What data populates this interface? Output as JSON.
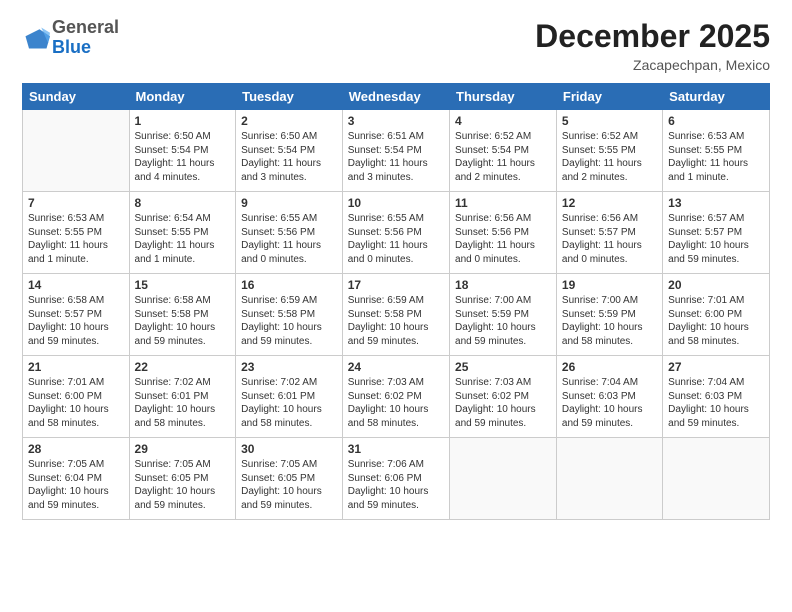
{
  "header": {
    "logo_general": "General",
    "logo_blue": "Blue",
    "month_title": "December 2025",
    "location": "Zacapechpan, Mexico"
  },
  "weekdays": [
    "Sunday",
    "Monday",
    "Tuesday",
    "Wednesday",
    "Thursday",
    "Friday",
    "Saturday"
  ],
  "weeks": [
    [
      {
        "num": "",
        "info": ""
      },
      {
        "num": "1",
        "info": "Sunrise: 6:50 AM\nSunset: 5:54 PM\nDaylight: 11 hours\nand 4 minutes."
      },
      {
        "num": "2",
        "info": "Sunrise: 6:50 AM\nSunset: 5:54 PM\nDaylight: 11 hours\nand 3 minutes."
      },
      {
        "num": "3",
        "info": "Sunrise: 6:51 AM\nSunset: 5:54 PM\nDaylight: 11 hours\nand 3 minutes."
      },
      {
        "num": "4",
        "info": "Sunrise: 6:52 AM\nSunset: 5:54 PM\nDaylight: 11 hours\nand 2 minutes."
      },
      {
        "num": "5",
        "info": "Sunrise: 6:52 AM\nSunset: 5:55 PM\nDaylight: 11 hours\nand 2 minutes."
      },
      {
        "num": "6",
        "info": "Sunrise: 6:53 AM\nSunset: 5:55 PM\nDaylight: 11 hours\nand 1 minute."
      }
    ],
    [
      {
        "num": "7",
        "info": "Sunrise: 6:53 AM\nSunset: 5:55 PM\nDaylight: 11 hours\nand 1 minute."
      },
      {
        "num": "8",
        "info": "Sunrise: 6:54 AM\nSunset: 5:55 PM\nDaylight: 11 hours\nand 1 minute."
      },
      {
        "num": "9",
        "info": "Sunrise: 6:55 AM\nSunset: 5:56 PM\nDaylight: 11 hours\nand 0 minutes."
      },
      {
        "num": "10",
        "info": "Sunrise: 6:55 AM\nSunset: 5:56 PM\nDaylight: 11 hours\nand 0 minutes."
      },
      {
        "num": "11",
        "info": "Sunrise: 6:56 AM\nSunset: 5:56 PM\nDaylight: 11 hours\nand 0 minutes."
      },
      {
        "num": "12",
        "info": "Sunrise: 6:56 AM\nSunset: 5:57 PM\nDaylight: 11 hours\nand 0 minutes."
      },
      {
        "num": "13",
        "info": "Sunrise: 6:57 AM\nSunset: 5:57 PM\nDaylight: 10 hours\nand 59 minutes."
      }
    ],
    [
      {
        "num": "14",
        "info": "Sunrise: 6:58 AM\nSunset: 5:57 PM\nDaylight: 10 hours\nand 59 minutes."
      },
      {
        "num": "15",
        "info": "Sunrise: 6:58 AM\nSunset: 5:58 PM\nDaylight: 10 hours\nand 59 minutes."
      },
      {
        "num": "16",
        "info": "Sunrise: 6:59 AM\nSunset: 5:58 PM\nDaylight: 10 hours\nand 59 minutes."
      },
      {
        "num": "17",
        "info": "Sunrise: 6:59 AM\nSunset: 5:58 PM\nDaylight: 10 hours\nand 59 minutes."
      },
      {
        "num": "18",
        "info": "Sunrise: 7:00 AM\nSunset: 5:59 PM\nDaylight: 10 hours\nand 59 minutes."
      },
      {
        "num": "19",
        "info": "Sunrise: 7:00 AM\nSunset: 5:59 PM\nDaylight: 10 hours\nand 58 minutes."
      },
      {
        "num": "20",
        "info": "Sunrise: 7:01 AM\nSunset: 6:00 PM\nDaylight: 10 hours\nand 58 minutes."
      }
    ],
    [
      {
        "num": "21",
        "info": "Sunrise: 7:01 AM\nSunset: 6:00 PM\nDaylight: 10 hours\nand 58 minutes."
      },
      {
        "num": "22",
        "info": "Sunrise: 7:02 AM\nSunset: 6:01 PM\nDaylight: 10 hours\nand 58 minutes."
      },
      {
        "num": "23",
        "info": "Sunrise: 7:02 AM\nSunset: 6:01 PM\nDaylight: 10 hours\nand 58 minutes."
      },
      {
        "num": "24",
        "info": "Sunrise: 7:03 AM\nSunset: 6:02 PM\nDaylight: 10 hours\nand 58 minutes."
      },
      {
        "num": "25",
        "info": "Sunrise: 7:03 AM\nSunset: 6:02 PM\nDaylight: 10 hours\nand 59 minutes."
      },
      {
        "num": "26",
        "info": "Sunrise: 7:04 AM\nSunset: 6:03 PM\nDaylight: 10 hours\nand 59 minutes."
      },
      {
        "num": "27",
        "info": "Sunrise: 7:04 AM\nSunset: 6:03 PM\nDaylight: 10 hours\nand 59 minutes."
      }
    ],
    [
      {
        "num": "28",
        "info": "Sunrise: 7:05 AM\nSunset: 6:04 PM\nDaylight: 10 hours\nand 59 minutes."
      },
      {
        "num": "29",
        "info": "Sunrise: 7:05 AM\nSunset: 6:05 PM\nDaylight: 10 hours\nand 59 minutes."
      },
      {
        "num": "30",
        "info": "Sunrise: 7:05 AM\nSunset: 6:05 PM\nDaylight: 10 hours\nand 59 minutes."
      },
      {
        "num": "31",
        "info": "Sunrise: 7:06 AM\nSunset: 6:06 PM\nDaylight: 10 hours\nand 59 minutes."
      },
      {
        "num": "",
        "info": ""
      },
      {
        "num": "",
        "info": ""
      },
      {
        "num": "",
        "info": ""
      }
    ]
  ]
}
